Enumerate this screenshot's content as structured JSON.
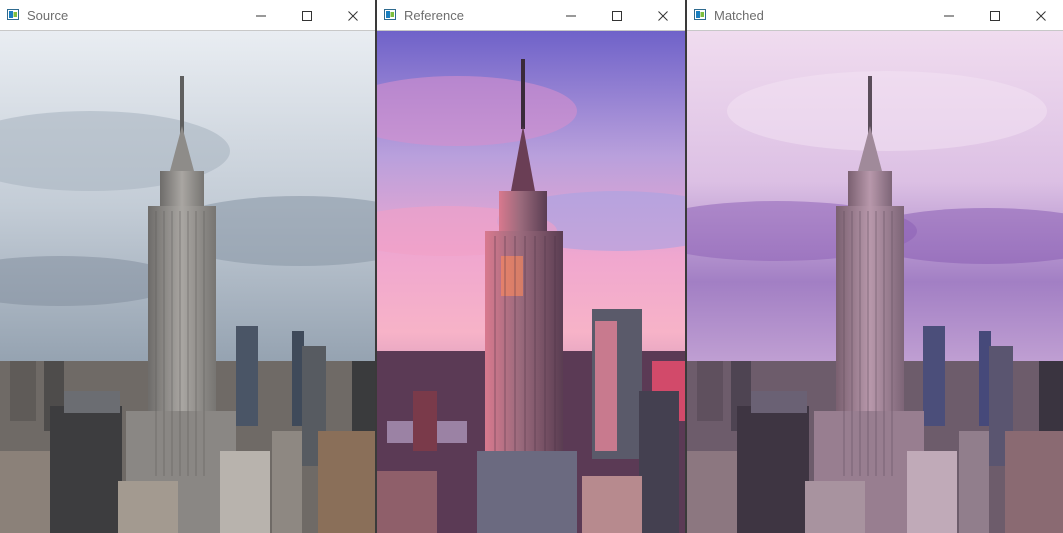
{
  "windows": [
    {
      "title": "Source",
      "scene": "source",
      "sky_top": "#d6dde6",
      "sky_bottom": "#8e9cab",
      "building": "#8b8a88",
      "building_dark": "#5c5d60"
    },
    {
      "title": "Reference",
      "scene": "reference",
      "sky_top": "#7b6ad6",
      "sky_bottom": "#f3a8c8",
      "building": "#8a5a6c",
      "building_dark": "#4c2f45"
    },
    {
      "title": "Matched",
      "scene": "matched",
      "sky_top": "#e8c6e8",
      "sky_bottom": "#a27fc4",
      "building": "#9d7f92",
      "building_dark": "#4f4355"
    }
  ],
  "caption_buttons": {
    "minimize": "minimize-icon",
    "maximize": "maximize-icon",
    "close": "close-icon"
  }
}
